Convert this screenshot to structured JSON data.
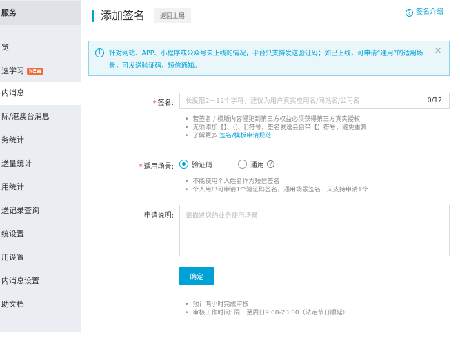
{
  "sidebar": {
    "items": [
      {
        "label": "服务",
        "state": "header"
      },
      {
        "label": "览",
        "state": ""
      },
      {
        "label": "速学习",
        "badge": "NEW",
        "state": ""
      },
      {
        "label": "内消息",
        "state": "active"
      },
      {
        "label": "际/港澳台消息",
        "state": ""
      },
      {
        "label": "务统计",
        "state": ""
      },
      {
        "label": "送量统计",
        "state": ""
      },
      {
        "label": "用统计",
        "state": ""
      },
      {
        "label": "送记录查询",
        "state": ""
      },
      {
        "label": "统设置",
        "state": ""
      },
      {
        "label": "用设置",
        "state": ""
      },
      {
        "label": "内消息设置",
        "state": ""
      },
      {
        "label": "助文档",
        "state": ""
      }
    ]
  },
  "header": {
    "title": "添加签名",
    "back_label": "返回上层",
    "intro_icon": "?",
    "intro_label": "签名介绍"
  },
  "notice": {
    "icon": "i",
    "text": "针对网站、APP、小程序或公众号未上线的情况，平台只支持发送验证码；如已上线，可申请“通用”的适用场景，可发送验证码、短信通知。",
    "close": "✕"
  },
  "form": {
    "required_mark": "*",
    "signature": {
      "label": "签名:",
      "placeholder": "长度限2－12个字符，建议为用户真实应用名/网站名/公司名",
      "value": "",
      "counter": "0/12",
      "hints": [
        "若签名 / 模版内容侵犯到第三方权益必须获得第三方真实授权",
        "无须添加【】、()、[]符号，签名发送会自带【】符号，避免重复"
      ],
      "hint_more_prefix": "了解更多",
      "hint_more_link": "签名/模板申请规范"
    },
    "scene": {
      "label": "适用场景:",
      "options": [
        {
          "label": "验证码",
          "checked": true
        },
        {
          "label": "通用",
          "checked": false
        }
      ],
      "help_icon": "?",
      "hints": [
        "不能使用个人姓名作为短信签名",
        "个人用户可申请1个验证码签名，通用场景签名一天支持申请1个"
      ]
    },
    "description": {
      "label": "申请说明:",
      "placeholder": "请描述您的业务使用场景",
      "value": ""
    },
    "submit_label": "确定",
    "footer_hints": [
      "预计两小时完成审核",
      "审核工作时间: 周一至周日9:00-23:00（法定节日顺延）"
    ]
  },
  "colors": {
    "accent": "#00a1d6",
    "required": "#f04134",
    "badge": "#f26b3a",
    "sidebar_bg": "#eaedf1",
    "notice_bg": "#e9f7fb"
  }
}
